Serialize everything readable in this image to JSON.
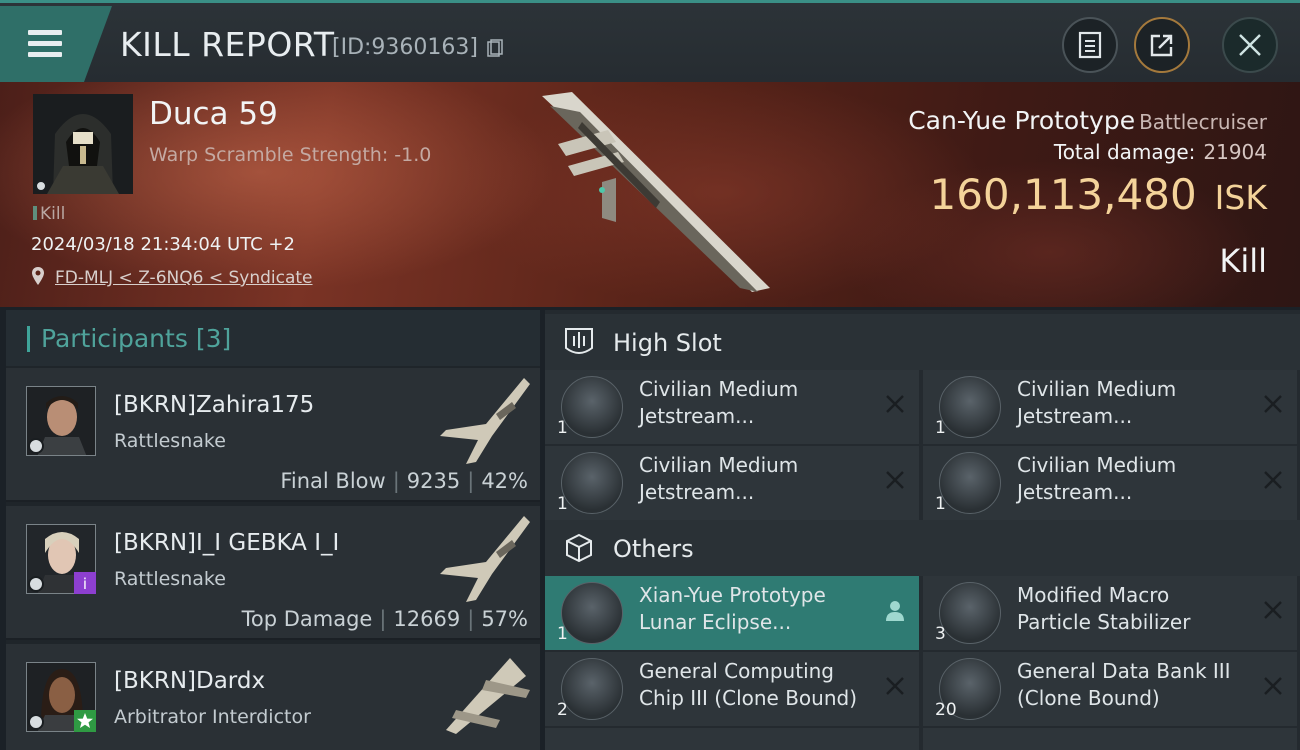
{
  "header": {
    "title": "KILL REPORT",
    "report_id": "[ID:9360163]",
    "accent": "#3a8f86"
  },
  "hero": {
    "victim_name": "Duca 59",
    "scramble": "Warp Scramble Strength: -1.0",
    "kill_tag": "Kill",
    "datetime": "2024/03/18 21:34:04 UTC +2",
    "location": "FD-MLJ < Z-6NQ6 < Syndicate",
    "ship_name": "Can-Yue Prototype",
    "ship_class": "Battlecruiser",
    "damage_label": "Total damage:",
    "damage_value": "21904",
    "isk_value": "160,113,480",
    "isk_unit": "ISK",
    "result": "Kill"
  },
  "participants": {
    "title": "Participants",
    "count": "[3]",
    "rows": [
      {
        "name": "[BKRN]Zahira175",
        "ship": "Rattlesnake",
        "label": "Final Blow",
        "damage": "9235",
        "percent": "42%"
      },
      {
        "name": "[BKRN]I_I GEBKA I_I",
        "ship": "Rattlesnake",
        "label": "Top Damage",
        "damage": "12669",
        "percent": "57%"
      },
      {
        "name": "[BKRN]Dardx",
        "ship": "Arbitrator Interdictor"
      }
    ]
  },
  "high_slot": {
    "title": "High Slot",
    "items": [
      {
        "qty": "1",
        "line1": "Civilian Medium",
        "line2": "Jetstream..."
      },
      {
        "qty": "1",
        "line1": "Civilian Medium",
        "line2": "Jetstream..."
      },
      {
        "qty": "1",
        "line1": "Civilian Medium",
        "line2": "Jetstream..."
      },
      {
        "qty": "1",
        "line1": "Civilian Medium",
        "line2": "Jetstream..."
      }
    ]
  },
  "others": {
    "title": "Others",
    "items": [
      {
        "qty": "1",
        "line1": "Xian-Yue Prototype",
        "line2": "Lunar Eclipse..."
      },
      {
        "qty": "3",
        "line1": "Modified Macro",
        "line2": "Particle Stabilizer"
      },
      {
        "qty": "2",
        "line1": "General Computing",
        "line2": "Chip III (Clone Bound)"
      },
      {
        "qty": "20",
        "line1": "General Data Bank III",
        "line2": "(Clone Bound)"
      }
    ]
  }
}
